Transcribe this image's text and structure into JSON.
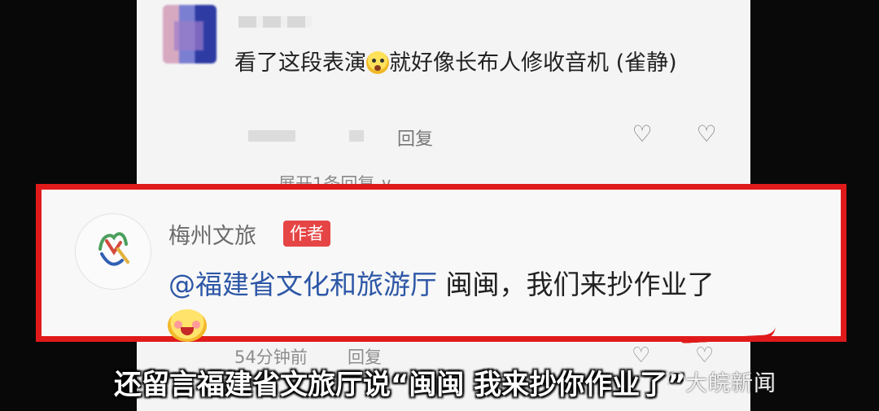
{
  "comments": [
    {
      "text_before_emoji": "看了这段表演",
      "text_after_emoji": "就好像长布人修收音机 (雀静)",
      "reply_label": "回复",
      "expand_label": "展开1条回复 ∨"
    }
  ],
  "author_reply": {
    "name": "梅州文旅",
    "tag": "作者",
    "mention": "@福建省文化和旅游厅",
    "text": " 闽闽，我们来抄作业了",
    "time": "54分钟前",
    "reply_label": "回复"
  },
  "subtitle": "还留言福建省文旅厅说“闽闽 我来抄你作业了”",
  "watermark": "大皖新闻",
  "icons": {
    "like": "heart-icon",
    "dislike": "broken-heart-icon",
    "emoji": "emoji-icon"
  },
  "colors": {
    "highlight": "#e01a1a",
    "author_tag": "#e64545",
    "mention": "#2d57a6"
  }
}
